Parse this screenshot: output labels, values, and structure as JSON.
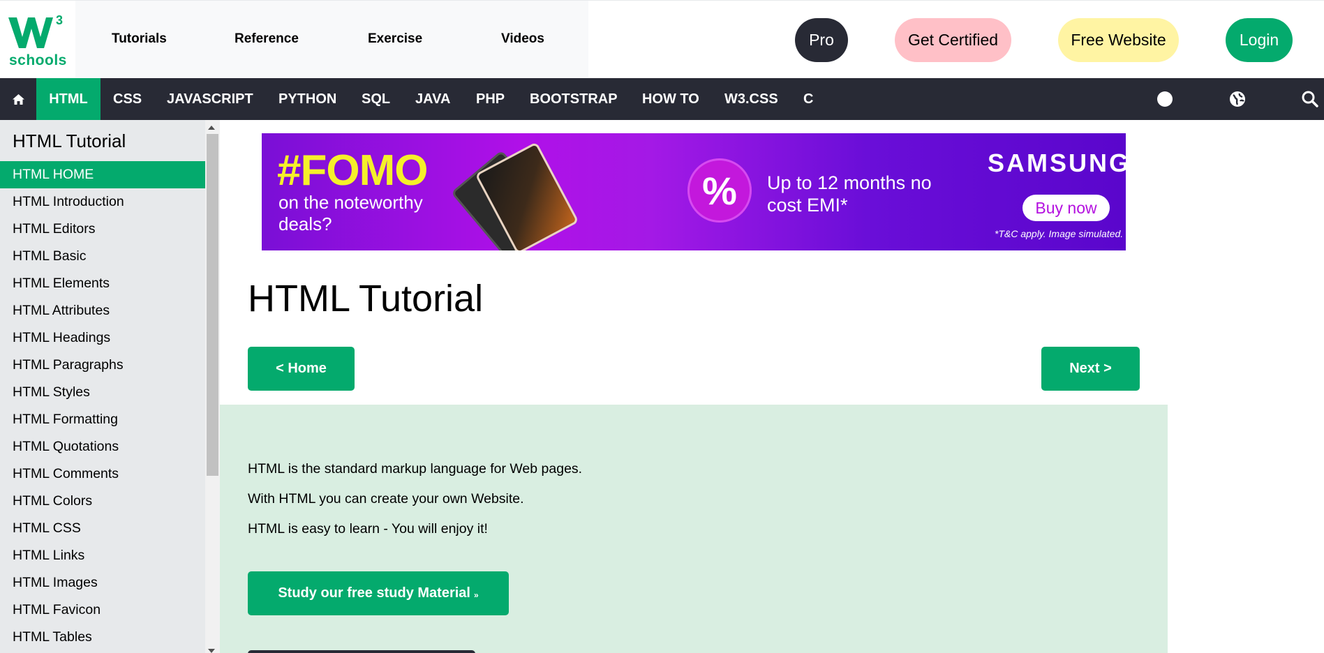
{
  "logo": {
    "word": "schools",
    "superscript": "3",
    "brand_color": "#04aa6d"
  },
  "topnav": {
    "links": [
      "Tutorials",
      "Reference",
      "Exercise",
      "Videos"
    ],
    "pro": "Pro",
    "certified": "Get Certified",
    "free_website": "Free Website",
    "login": "Login"
  },
  "subnav": {
    "items": [
      "HTML",
      "CSS",
      "JAVASCRIPT",
      "PYTHON",
      "SQL",
      "JAVA",
      "PHP",
      "BOOTSTRAP",
      "HOW TO",
      "W3.CSS",
      "C"
    ],
    "active": "HTML",
    "icons": [
      "home-icon",
      "dark-mode-icon",
      "globe-icon",
      "search-icon"
    ]
  },
  "sidebar": {
    "title": "HTML Tutorial",
    "items": [
      "HTML HOME",
      "HTML Introduction",
      "HTML Editors",
      "HTML Basic",
      "HTML Elements",
      "HTML Attributes",
      "HTML Headings",
      "HTML Paragraphs",
      "HTML Styles",
      "HTML Formatting",
      "HTML Quotations",
      "HTML Comments",
      "HTML Colors",
      "HTML CSS",
      "HTML Links",
      "HTML Images",
      "HTML Favicon",
      "HTML Tables"
    ],
    "active": "HTML HOME"
  },
  "ad": {
    "headline": "#FOMO",
    "subline": "on the noteworthy deals?",
    "percent": "%",
    "offer": "Up to 12 months no cost EMI*",
    "brand": "SAMSUNG",
    "cta": "Buy now",
    "disclaimer": "*T&C apply. Image simulated."
  },
  "main": {
    "title": "HTML Tutorial",
    "prev_button": "< Home",
    "next_button": "Next >",
    "intro_lines": [
      "HTML is the standard markup language for Web pages.",
      "With HTML you can create your own Website.",
      "HTML is easy to learn - You will enjoy it!"
    ],
    "study_button": "Study our free study Material",
    "study_button_suffix": "»"
  },
  "colors": {
    "green": "#04aa6d",
    "dark": "#282a35",
    "pink": "#ffc0c7",
    "yellow": "#fff4a3",
    "intro_bg": "#d9eee1",
    "sidebar_bg": "#e7e9eb"
  }
}
